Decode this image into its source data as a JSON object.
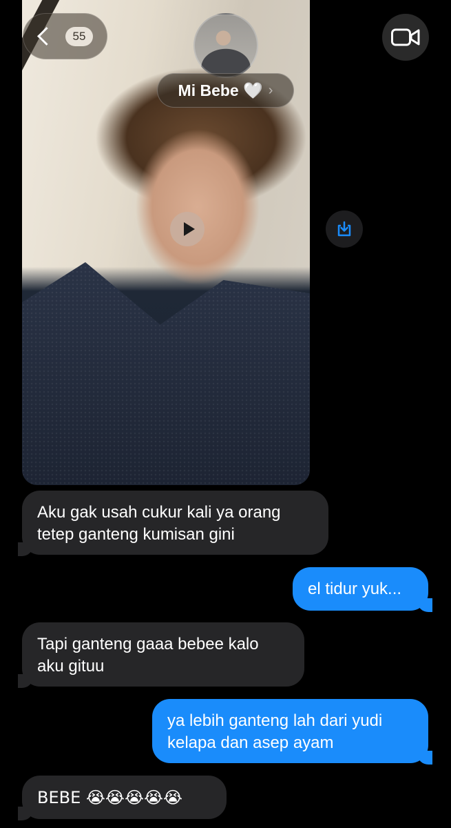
{
  "header": {
    "unread_count": "55",
    "contact_name": "Mi Bebe 🤍",
    "name_chevron": "›"
  },
  "messages": [
    {
      "direction": "incoming",
      "text": "Aku gak usah cukur kali ya orang tetep ganteng kumisan gini"
    },
    {
      "direction": "outgoing",
      "text": "el tidur yuk..."
    },
    {
      "direction": "incoming",
      "text": "Tapi ganteng gaaa bebee kalo aku gituu"
    },
    {
      "direction": "outgoing",
      "text": "ya lebih ganteng lah dari yudi kelapa dan asep ayam"
    },
    {
      "direction": "incoming",
      "text": "BEBE 😭😭😭😭😭"
    }
  ],
  "icons": {
    "back": "chevron-left-icon",
    "video_call": "video-camera-icon",
    "play": "play-icon",
    "save": "save-download-icon"
  },
  "colors": {
    "outgoing_bubble": "#1a8cfb",
    "incoming_bubble": "#262628",
    "background": "#000000"
  }
}
